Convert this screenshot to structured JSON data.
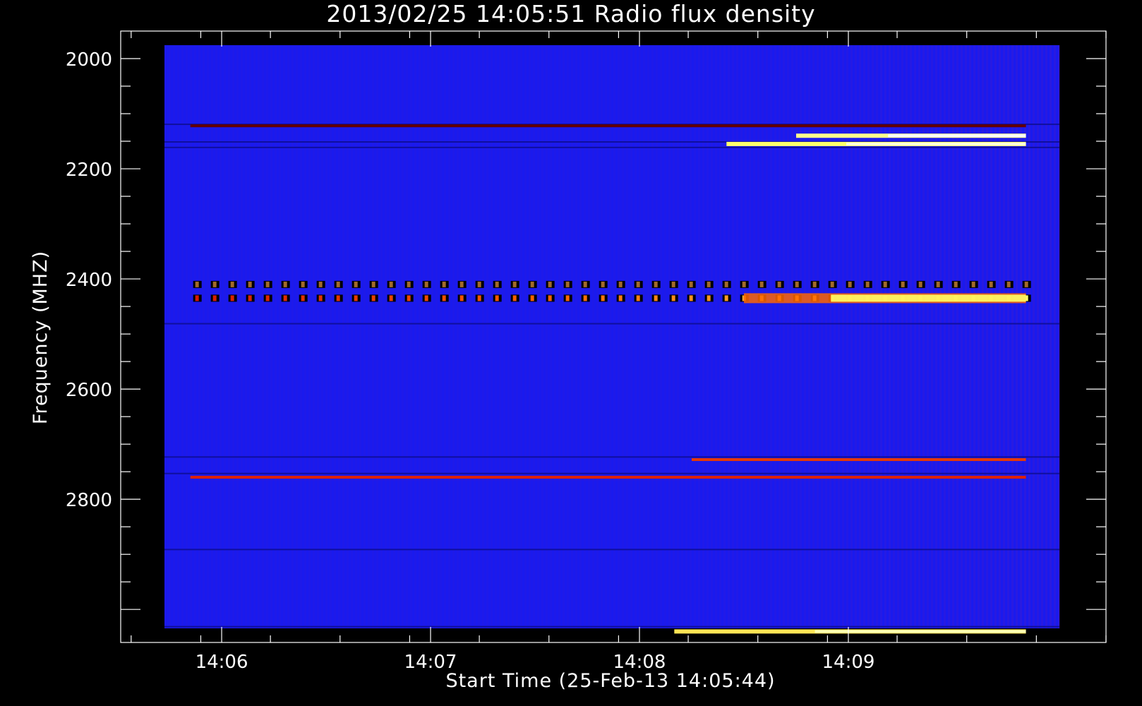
{
  "chart_data": {
    "type": "heatmap",
    "title": "2013/02/25 14:05:51 Radio flux density",
    "xlabel": "Start Time (25-Feb-13 14:05:44)",
    "ylabel": "Frequency (MHZ)",
    "x_range_seconds_from_start": [
      -13,
      270
    ],
    "data_time_span": [
      "14:05:51",
      "14:09:51"
    ],
    "ylim": [
      3060,
      1950
    ],
    "y_axis_inverted": true,
    "x_tick_labels": [
      "14:06",
      "14:07",
      "14:08",
      "14:09"
    ],
    "x_tick_times": [
      "14:06:00",
      "14:07:00",
      "14:08:00",
      "14:09:00"
    ],
    "y_tick_labels": [
      "2000",
      "2200",
      "2400",
      "2600",
      "2800"
    ],
    "y_tick_values": [
      2000,
      2200,
      2400,
      2600,
      2800
    ],
    "colormap": [
      "#0000ff",
      "#000000",
      "#cc0000",
      "#ff6600",
      "#ffff66",
      "#ffffff"
    ],
    "background_color": "#1a1aee",
    "emission_bands": [
      {
        "freq_mhz": 2122,
        "start": "14:05:51",
        "end": "14:09:51",
        "intensity": 0.35
      },
      {
        "freq_mhz": 2155,
        "start": "14:08:25",
        "end": "14:09:51",
        "intensity": 0.95
      },
      {
        "freq_mhz": 2140,
        "start": "14:08:45",
        "end": "14:09:51",
        "intensity": 1.0
      },
      {
        "freq_mhz": 2410,
        "start": "14:05:51",
        "end": "14:09:51",
        "intensity": 0.2,
        "pattern": "periodic"
      },
      {
        "freq_mhz": 2435,
        "start": "14:05:51",
        "end": "14:09:51",
        "intensity": 0.85,
        "pattern": "periodic"
      },
      {
        "freq_mhz": 2728,
        "start": "14:08:15",
        "end": "14:09:51",
        "intensity": 0.6
      },
      {
        "freq_mhz": 2760,
        "start": "14:05:51",
        "end": "14:09:51",
        "intensity": 0.55
      },
      {
        "freq_mhz": 3040,
        "start": "14:08:10",
        "end": "14:09:51",
        "intensity": 0.9
      }
    ]
  }
}
